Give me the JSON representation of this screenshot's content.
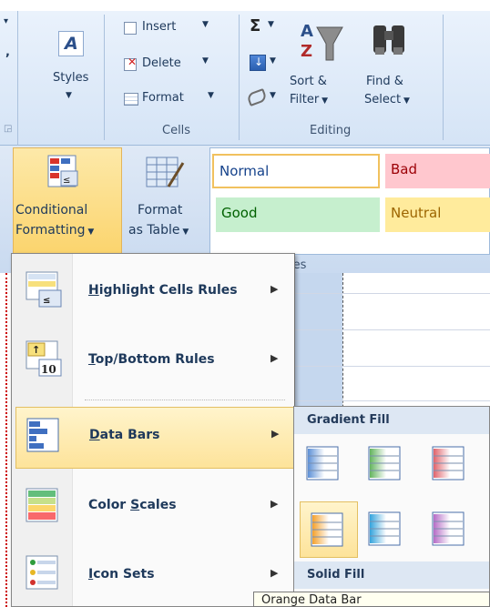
{
  "ribbon": {
    "styles_label": "Styles",
    "cells": {
      "insert": "Insert",
      "delete": "Delete",
      "format": "Format",
      "group_label": "Cells"
    },
    "editing": {
      "sigma": "Σ",
      "sort_filter_line1": "Sort &",
      "sort_filter_line2": "Filter",
      "find_select_line1": "Find &",
      "find_select_line2": "Select",
      "group_label": "Editing"
    },
    "conditional_formatting": {
      "line1": "Conditional",
      "line2": "Formatting"
    },
    "format_as_table": {
      "line1": "Format",
      "line2": "as Table"
    },
    "cell_styles": [
      {
        "label": "Normal",
        "bg": "#ffffff",
        "fg": "#000000"
      },
      {
        "label": "Bad",
        "bg": "#ffc7ce",
        "fg": "#9c0006"
      },
      {
        "label": "Good",
        "bg": "#c6efce",
        "fg": "#006100"
      },
      {
        "label": "Neutral",
        "bg": "#ffeb9c",
        "fg": "#9c6500"
      }
    ],
    "styles_group_fragment": "les"
  },
  "menu": {
    "items": [
      {
        "label": "Highlight Cells Rules",
        "u": "H",
        "rest": "ighlight Cells Rules",
        "icon": "highlight-cells-icon"
      },
      {
        "label": "Top/Bottom Rules",
        "u": "T",
        "rest": "op/Bottom Rules",
        "icon": "top-bottom-icon",
        "icon_text": "10"
      },
      {
        "label": "Data Bars",
        "u": "D",
        "rest": "ata Bars",
        "icon": "data-bars-icon"
      },
      {
        "label": "Color Scales",
        "pre": "Color ",
        "u": "S",
        "rest": "cales",
        "icon": "color-scales-icon"
      },
      {
        "label": "Icon Sets",
        "u": "I",
        "rest": "con Sets",
        "icon": "icon-sets-icon"
      }
    ]
  },
  "submenu": {
    "gradient_heading": "Gradient Fill",
    "solid_heading": "Solid Fill",
    "tooltip": "Orange Data Bar",
    "colors": [
      "#5b8fd6",
      "#63b45e",
      "#e0636b",
      "#f4a12c",
      "#33a3dc",
      "#b66cc6"
    ]
  }
}
